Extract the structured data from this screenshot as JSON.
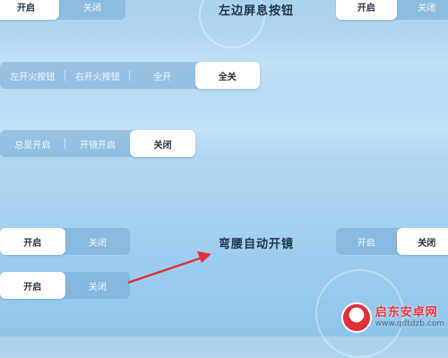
{
  "colors": {
    "accent_arrow": "#e0313b",
    "active_bg": "#ffffff",
    "inactive_bg": "#74aad6"
  },
  "rows": [
    {
      "id": "top-left",
      "options": [
        "开启",
        "关闭"
      ],
      "active": 0
    },
    {
      "id": "top-right",
      "options": [
        "开启",
        "关闭"
      ],
      "active": 0
    },
    {
      "id": "fire",
      "options": [
        "左开火按钮",
        "右开火按钮",
        "全开",
        "全关"
      ],
      "active": 3
    },
    {
      "id": "scope",
      "options": [
        "总是开启",
        "开镜开启",
        "关闭"
      ],
      "active": 2
    },
    {
      "id": "crouch-left",
      "options": [
        "开启",
        "关闭"
      ],
      "active": 0
    },
    {
      "id": "crouch-right",
      "options": [
        "开启",
        "关闭"
      ],
      "active": 1
    },
    {
      "id": "bottom-left",
      "options": [
        "开启",
        "关闭"
      ],
      "active": 0
    }
  ],
  "titles": {
    "left_screen_button": "左边屏息按钮",
    "crouch_auto_scope": "弯腰自动开镜"
  },
  "watermark": {
    "name": "启东安卓网",
    "url": "www.qdtdzb.com",
    "icon": "logo-icon"
  }
}
